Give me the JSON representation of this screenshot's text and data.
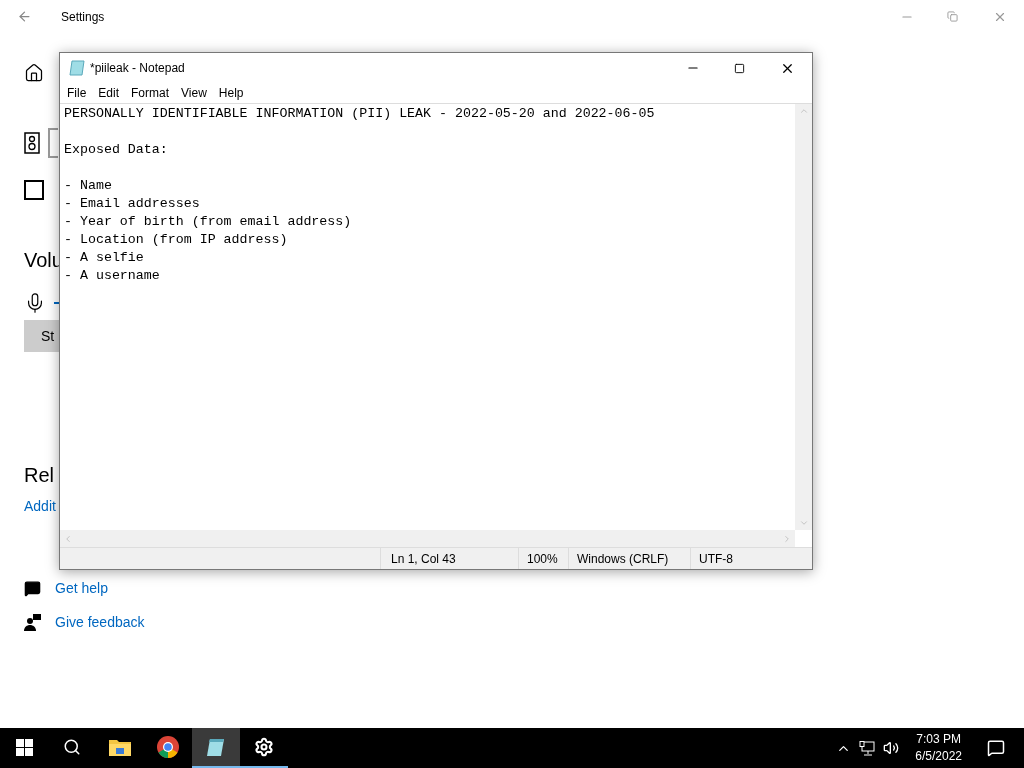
{
  "settings": {
    "title": "Settings",
    "checkbox": {
      "checked": false
    },
    "fragments": {
      "volume_heading": "Volu",
      "store_button": "St",
      "related_heading": "Rel",
      "additional_link": "Addit"
    },
    "help_links": [
      {
        "kind": "help",
        "label": "Get help"
      },
      {
        "kind": "feedback",
        "label": "Give feedback"
      }
    ]
  },
  "notepad": {
    "title": "*piileak - Notepad",
    "menu": [
      "File",
      "Edit",
      "Format",
      "View",
      "Help"
    ],
    "lines": [
      {
        "kind": "text",
        "text": "PERSONALLY IDENTIFIABLE INFORMATION (PII) LEAK - 2022-05-20 and 2022-06-05"
      },
      {
        "kind": "blank"
      },
      {
        "kind": "text",
        "text": "Exposed Data:"
      },
      {
        "kind": "blank"
      },
      {
        "kind": "text",
        "text": "- Name"
      },
      {
        "kind": "text",
        "text": "- Email addresses"
      },
      {
        "kind": "text",
        "text": "- Year of birth (from email address)"
      },
      {
        "kind": "text",
        "text": "- Location (from IP address)"
      },
      {
        "kind": "text",
        "text": "- A selfie"
      },
      {
        "kind": "text",
        "text": "- A username"
      }
    ],
    "status": {
      "position": "Ln 1, Col 43",
      "zoom": "100%",
      "line_endings": "Windows (CRLF)",
      "encoding": "UTF-8"
    }
  },
  "taskbar": {
    "apps": [
      {
        "kind": "start",
        "open": false,
        "selected": false
      },
      {
        "kind": "search",
        "open": false,
        "selected": false
      },
      {
        "kind": "folder",
        "open": false,
        "selected": false
      },
      {
        "kind": "browser",
        "open": false,
        "selected": false
      },
      {
        "kind": "notepad",
        "open": true,
        "selected": true
      },
      {
        "kind": "settings",
        "open": true,
        "selected": false
      }
    ],
    "time": "7:03 PM",
    "date": "6/5/2022"
  }
}
